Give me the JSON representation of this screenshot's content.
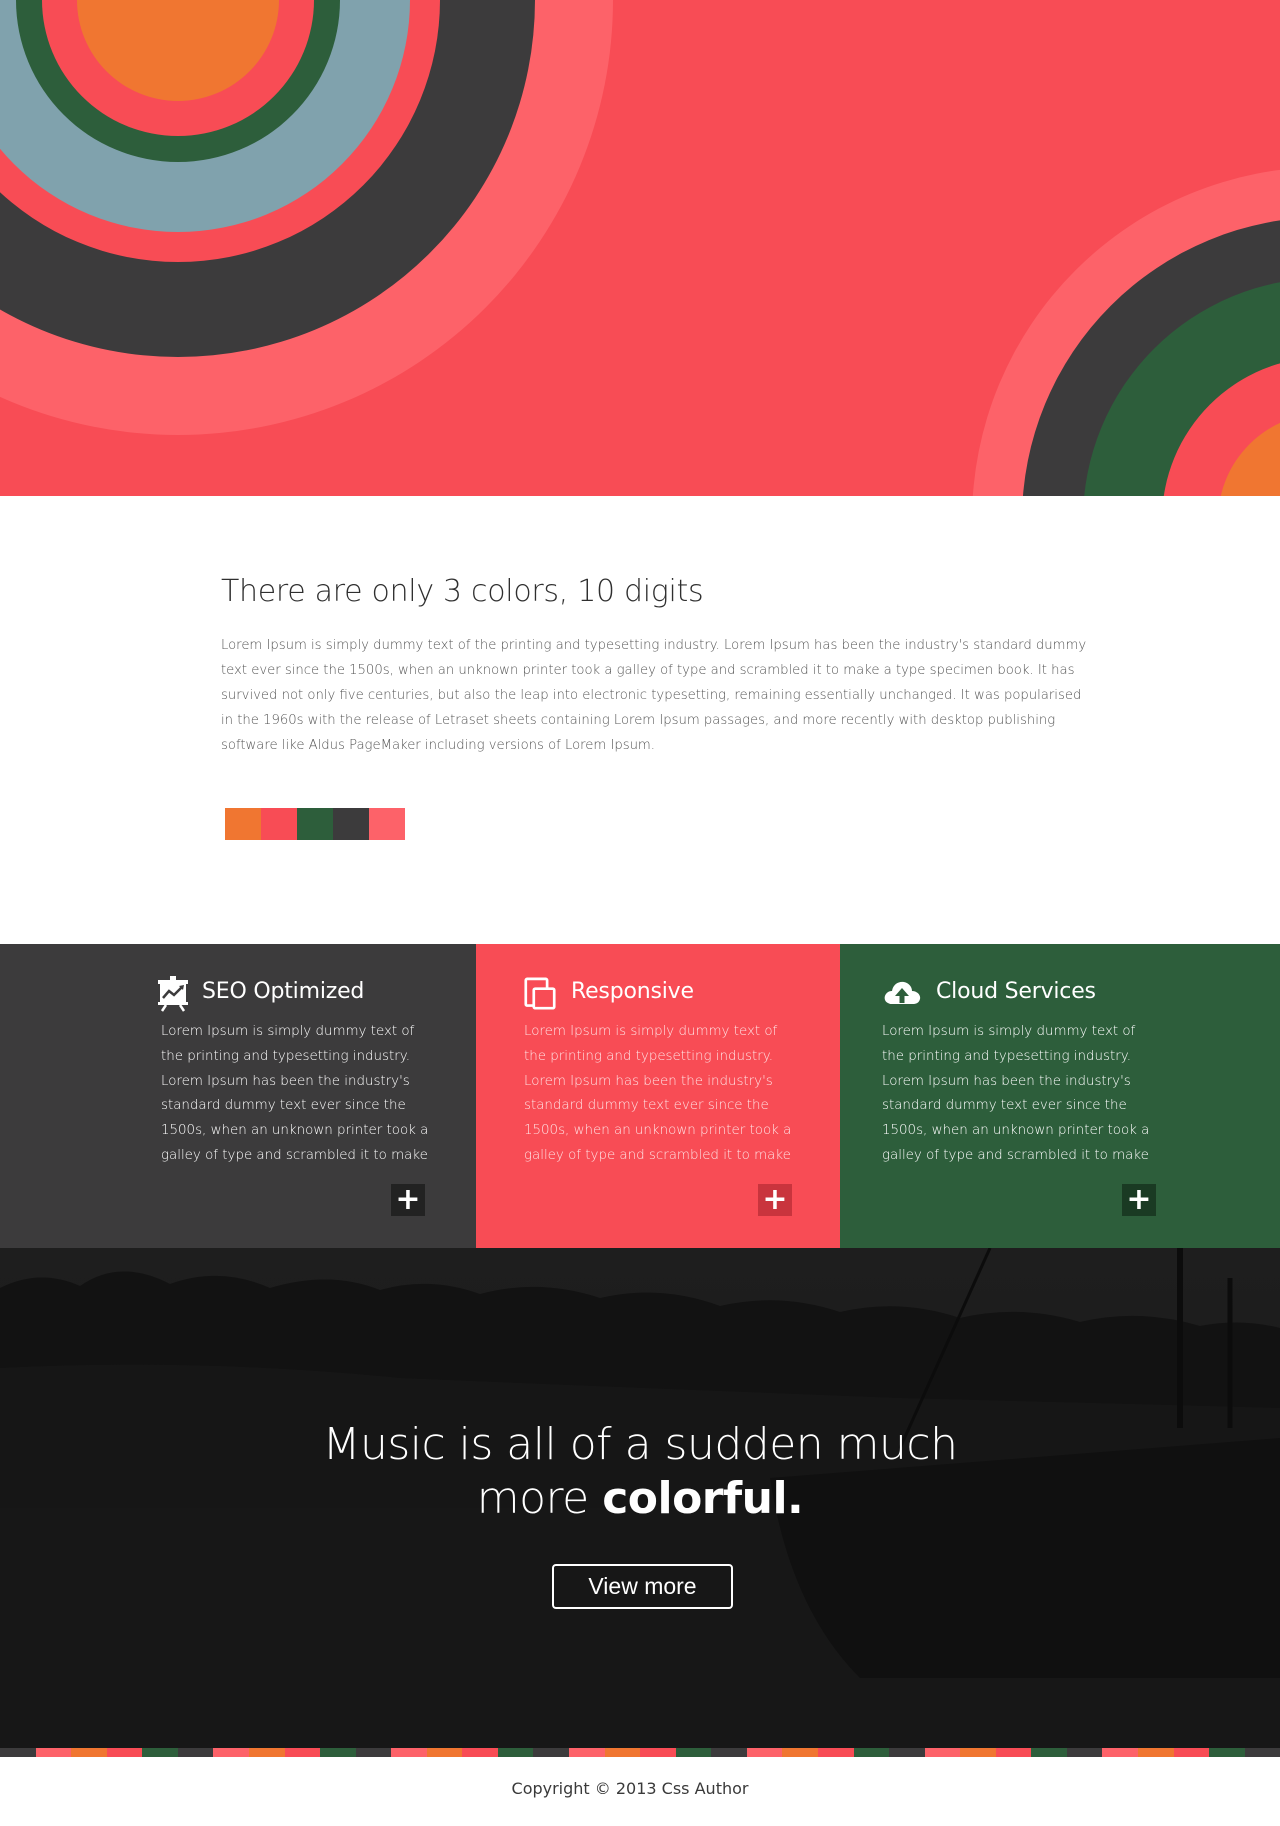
{
  "palette": {
    "orange": "#f07631",
    "red": "#f84c55",
    "green": "#2d5e3b",
    "charcoal": "#3c3b3c",
    "pink": "#fd6269",
    "slate": "#80a2ad"
  },
  "intro": {
    "title": "There are only 3 colors, 10 digits",
    "body": "Lorem Ipsum is simply dummy text of the printing and typesetting industry. Lorem Ipsum has been the industry's standard dummy text ever since the 1500s, when an unknown printer took a galley of type and scrambled it to make a type specimen book. It has survived not only five centuries, but also the leap into electronic typesetting, remaining essentially unchanged. It was popularised in the 1960s with the release of Letraset sheets containing Lorem Ipsum passages, and more recently with desktop publishing software like Aldus PageMaker including versions of Lorem Ipsum.",
    "swatches": [
      "#f07631",
      "#f84c55",
      "#2d5e3b",
      "#3c3b3c",
      "#fd6269"
    ]
  },
  "features": [
    {
      "title": "SEO Optimized",
      "icon": "presentation-chart-icon",
      "body": "Lorem Ipsum is simply dummy text of the printing and typesetting industry. Lorem Ipsum has been the industry's standard dummy text ever since the 1500s, when an unknown printer took a galley of type and scrambled it to make",
      "more_label": "+"
    },
    {
      "title": "Responsive",
      "icon": "devices-icon",
      "body": "Lorem Ipsum is simply dummy text of the printing and typesetting industry. Lorem Ipsum has been the industry's standard dummy text ever since the 1500s, when an unknown printer took a galley of type and scrambled it to make",
      "more_label": "+"
    },
    {
      "title": "Cloud Services",
      "icon": "cloud-upload-icon",
      "body": "Lorem Ipsum is simply dummy text of the printing and typesetting industry. Lorem Ipsum has been the industry's standard dummy text ever since the 1500s, when an unknown printer took a galley of type and scrambled it to make",
      "more_label": "+"
    }
  ],
  "banner": {
    "line1": "Music is all of a sudden much",
    "line2_prefix": "more ",
    "line2_bold": "colorful.",
    "button_label": "View more"
  },
  "stripe_colors": [
    "#3c3b3c",
    "#fd6269",
    "#f07631",
    "#f84c55",
    "#2d5e3b",
    "#3c3b3c",
    "#fd6269",
    "#f07631",
    "#f84c55",
    "#2d5e3b",
    "#3c3b3c",
    "#fd6269",
    "#f07631",
    "#f84c55",
    "#2d5e3b",
    "#3c3b3c",
    "#fd6269",
    "#f07631",
    "#f84c55",
    "#2d5e3b",
    "#3c3b3c",
    "#fd6269",
    "#f07631",
    "#f84c55",
    "#2d5e3b",
    "#3c3b3c",
    "#fd6269",
    "#f07631",
    "#f84c55",
    "#2d5e3b",
    "#3c3b3c",
    "#fd6269",
    "#f07631",
    "#f84c55",
    "#2d5e3b",
    "#3c3b3c"
  ],
  "footer": {
    "copyright": "Copyright © 2013 Css Author"
  }
}
